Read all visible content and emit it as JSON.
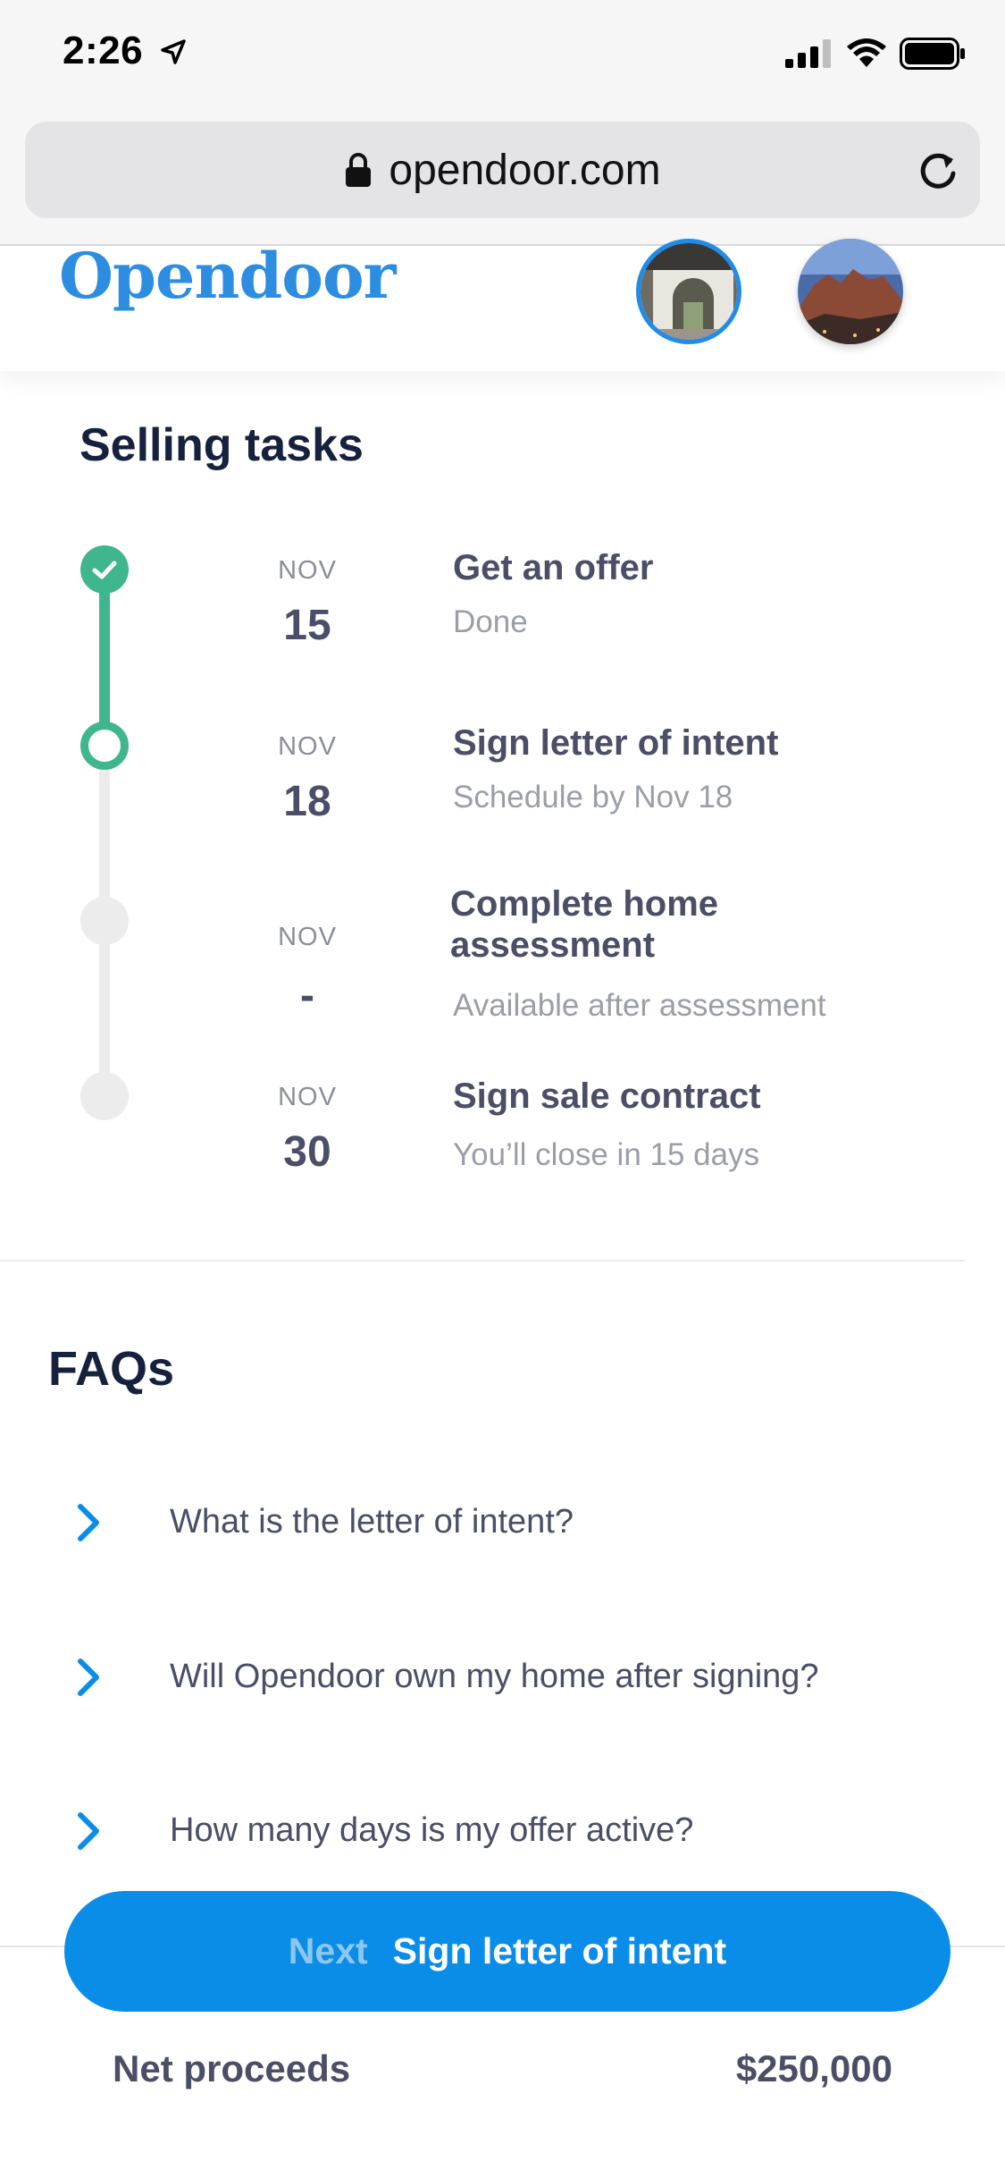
{
  "status_bar": {
    "time": "2:26",
    "icons": [
      "location-arrow-icon",
      "cellular-signal-icon",
      "wifi-icon",
      "battery-icon"
    ]
  },
  "browser": {
    "url": "opendoor.com",
    "icons": [
      "lock-icon",
      "reload-icon"
    ]
  },
  "header": {
    "logo_text": "Opendoor"
  },
  "selling_tasks": {
    "title": "Selling tasks",
    "items": [
      {
        "month": "NOV",
        "day": "15",
        "title": "Get an offer",
        "subtitle": "Done",
        "state": "done"
      },
      {
        "month": "NOV",
        "day": "18",
        "title": "Sign letter of intent",
        "subtitle": "Schedule by Nov 18",
        "state": "current"
      },
      {
        "month": "NOV",
        "day": "-",
        "title": "Complete home assessment",
        "subtitle": "Available after assessment",
        "state": "todo"
      },
      {
        "month": "NOV",
        "day": "30",
        "title": "Sign sale contract",
        "subtitle": "You’ll close in 15 days",
        "state": "todo"
      }
    ]
  },
  "faqs": {
    "title": "FAQs",
    "items": [
      {
        "question": "What is the letter of intent?"
      },
      {
        "question": "Will Opendoor own my home after signing?"
      },
      {
        "question": "How many days is my offer active?"
      }
    ]
  },
  "cta": {
    "prefix": "Next",
    "label": "Sign letter of intent"
  },
  "footer": {
    "net_label": "Net proceeds",
    "net_value": "$250,000"
  },
  "colors": {
    "brand_blue": "#0a8de8",
    "logo_blue": "#2d8de0",
    "progress_green": "#3fb68e"
  }
}
